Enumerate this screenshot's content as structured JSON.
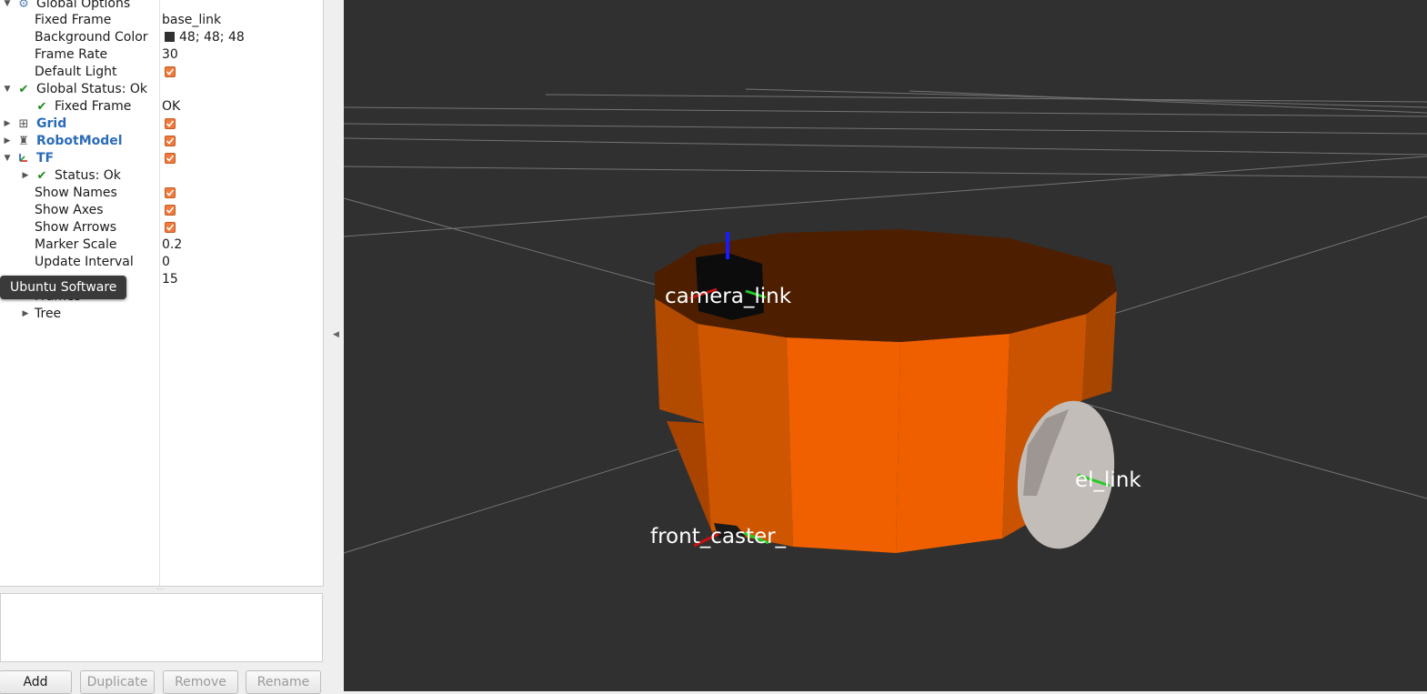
{
  "displays": {
    "global_options": {
      "label": "Global Options",
      "fixed_frame_label": "Fixed Frame",
      "fixed_frame_value": "base_link",
      "background_color_label": "Background Color",
      "background_color_value": "48; 48; 48",
      "background_color_hex": "#303030",
      "frame_rate_label": "Frame Rate",
      "frame_rate_value": "30",
      "default_light_label": "Default Light",
      "default_light_checked": true
    },
    "global_status": {
      "label": "Global Status: Ok",
      "fixed_frame_label": "Fixed Frame",
      "fixed_frame_value": "OK"
    },
    "grid": {
      "label": "Grid",
      "enabled": true,
      "icon": "grid-icon"
    },
    "robot_model": {
      "label": "RobotModel",
      "enabled": true,
      "icon": "robot-icon"
    },
    "tf": {
      "label": "TF",
      "enabled": true,
      "icon": "axes-icon",
      "status_label": "Status: Ok",
      "show_names_label": "Show Names",
      "show_axes_label": "Show Axes",
      "show_arrows_label": "Show Arrows",
      "marker_scale_label": "Marker Scale",
      "marker_scale_value": "0.2",
      "update_interval_label": "Update Interval",
      "update_interval_value": "0",
      "frame_timeout_value": "15",
      "frames_label": "Frames",
      "tree_label": "Tree"
    }
  },
  "tooltip": "Ubuntu Software",
  "buttons": {
    "add": "Add",
    "duplicate": "Duplicate",
    "remove": "Remove",
    "rename": "Rename"
  },
  "viewport": {
    "background": "#303030",
    "robot_color": "#f06000",
    "labels": {
      "camera": "camera_link",
      "front_caster": "front_caster_",
      "wheel": "el_link"
    }
  }
}
